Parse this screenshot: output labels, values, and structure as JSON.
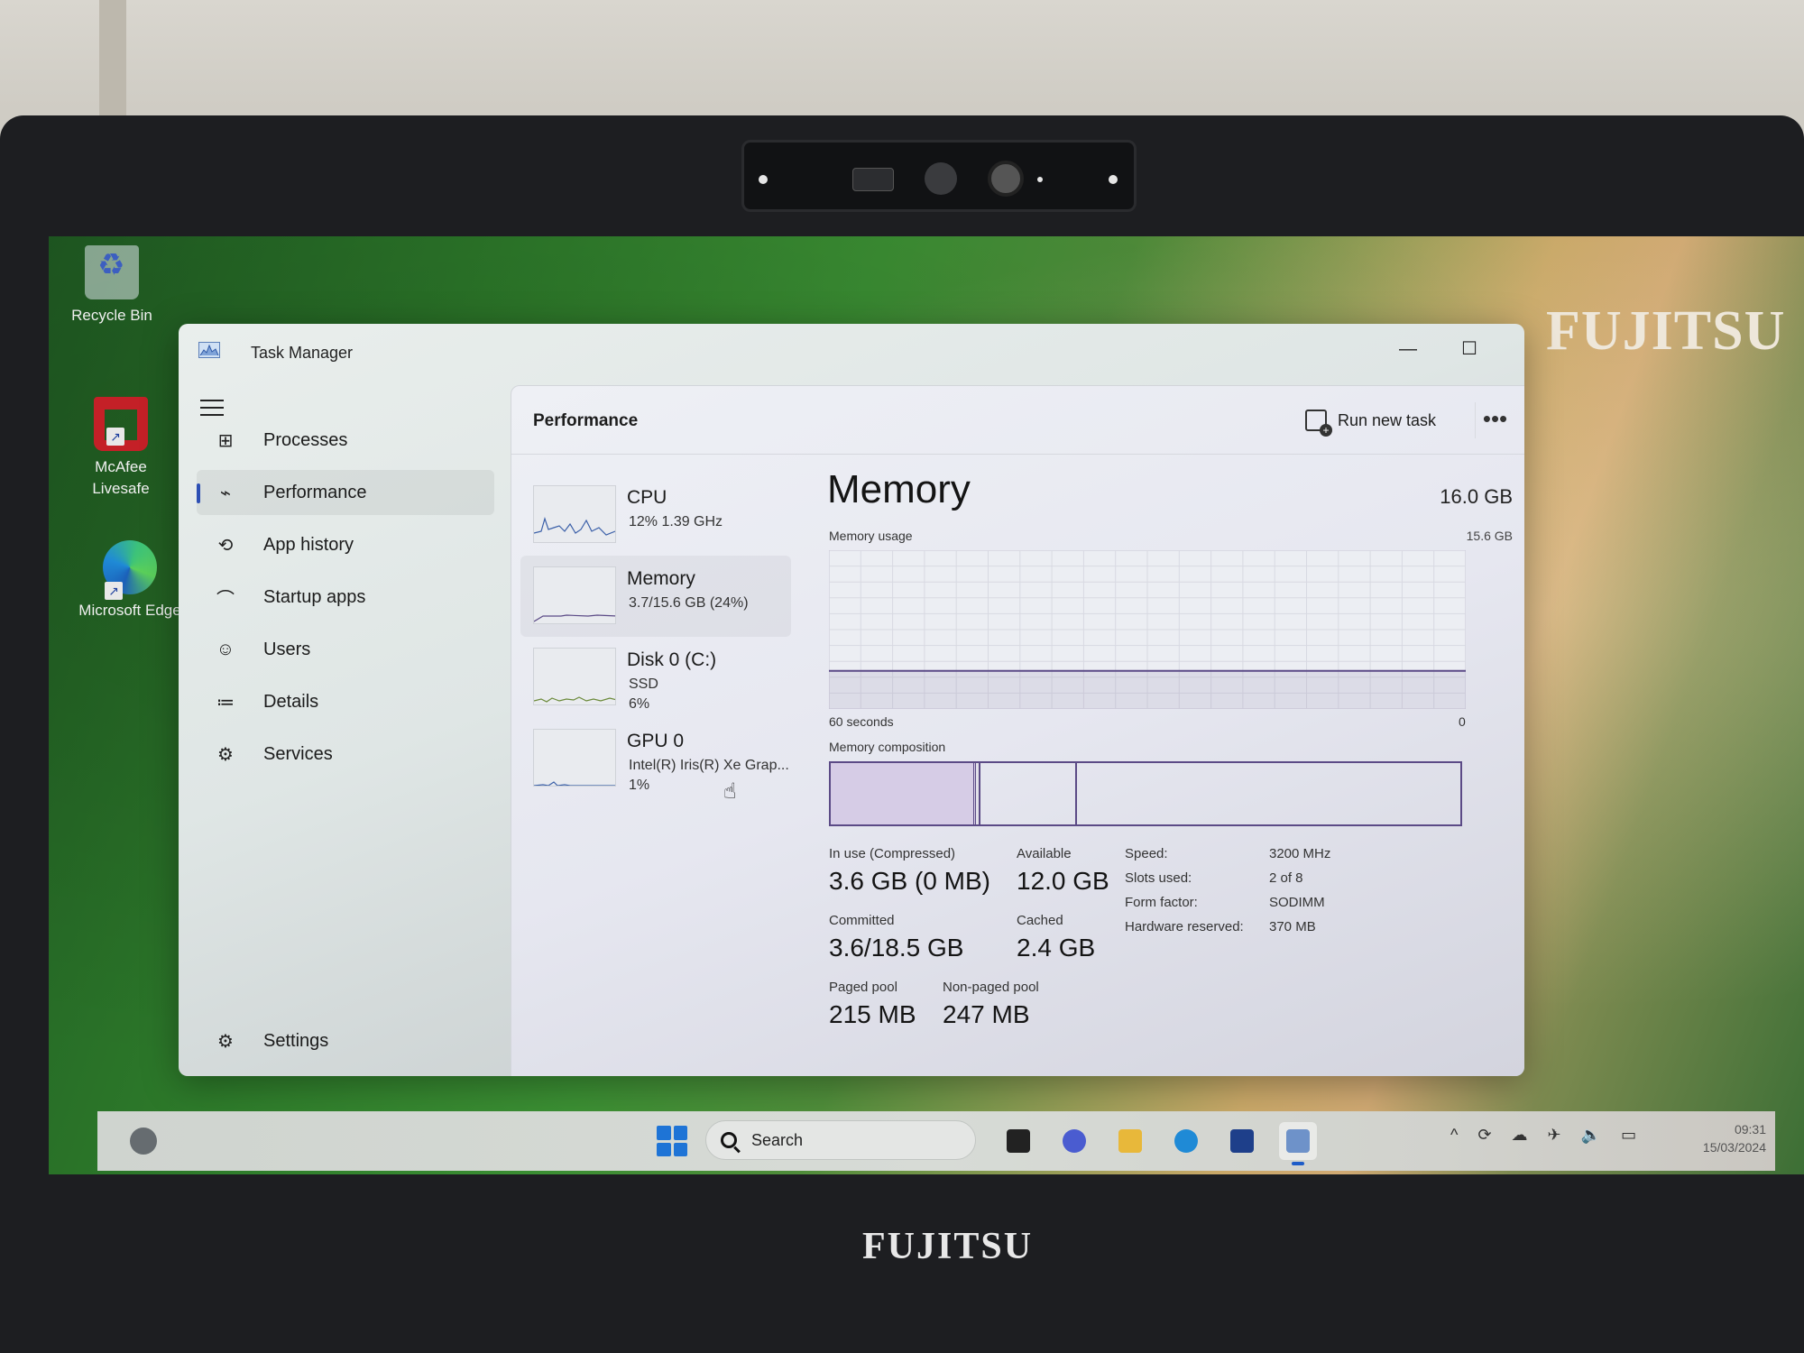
{
  "desktop": {
    "brand": "FUJITSU",
    "icons": [
      {
        "label": "Recycle Bin",
        "icon": "recycle-bin-icon"
      },
      {
        "label": "McAfee Livesafe",
        "icon": "mcafee-icon"
      },
      {
        "label": "Microsoft Edge",
        "icon": "edge-icon"
      }
    ]
  },
  "laptop": {
    "bezel_brand": "FUJITSU"
  },
  "window": {
    "title": "Task Manager",
    "controls": {
      "minimize": "—",
      "maximize": "☐",
      "close": "✕"
    }
  },
  "sidebar": {
    "menu_icon": "hamburger-icon",
    "items": [
      {
        "label": "Processes",
        "icon": "processes-icon",
        "glyph": "⊞",
        "active": false
      },
      {
        "label": "Performance",
        "icon": "performance-icon",
        "glyph": "⌁",
        "active": true
      },
      {
        "label": "App history",
        "icon": "app-history-icon",
        "glyph": "⟲",
        "active": false
      },
      {
        "label": "Startup apps",
        "icon": "startup-apps-icon",
        "glyph": "⌒",
        "active": false
      },
      {
        "label": "Users",
        "icon": "users-icon",
        "glyph": "☺",
        "active": false
      },
      {
        "label": "Details",
        "icon": "details-icon",
        "glyph": "≔",
        "active": false
      },
      {
        "label": "Services",
        "icon": "services-icon",
        "glyph": "⚙",
        "active": false
      }
    ],
    "settings_label": "Settings"
  },
  "header": {
    "title": "Performance",
    "run_new_task": "Run new task",
    "more": "•••"
  },
  "resources": [
    {
      "name": "CPU",
      "line1": "12%  1.39 GHz",
      "line2": "",
      "selected": false,
      "color": "#3a5fa8"
    },
    {
      "name": "Memory",
      "line1": "3.7/15.6 GB (24%)",
      "line2": "",
      "selected": true,
      "color": "#5b4a86"
    },
    {
      "name": "Disk 0 (C:)",
      "line1": "SSD",
      "line2": "6%",
      "selected": false,
      "color": "#6b8a3a"
    },
    {
      "name": "GPU 0",
      "line1": "Intel(R) Iris(R) Xe Grap...",
      "line2": "1%",
      "selected": false,
      "color": "#3a5fa8"
    }
  ],
  "memory": {
    "title": "Memory",
    "total": "16.0 GB",
    "usage_label": "Memory usage",
    "usage_max": "15.6 GB",
    "axis_left": "60 seconds",
    "axis_right": "0",
    "usage_fraction": 0.24,
    "composition_label": "Memory composition",
    "composition": {
      "in_use_gb": 3.6,
      "modified_gb": 0.1,
      "standby_gb": 2.4,
      "free_gb": 9.5
    },
    "stats": [
      {
        "label": "In use (Compressed)",
        "value": "3.6 GB (0 MB)"
      },
      {
        "label": "Available",
        "value": "12.0 GB"
      },
      {
        "label": "Committed",
        "value": "3.6/18.5 GB"
      },
      {
        "label": "Cached",
        "value": "2.4 GB"
      },
      {
        "label": "Paged pool",
        "value": "215 MB"
      },
      {
        "label": "Non-paged pool",
        "value": "247 MB"
      }
    ],
    "specs": [
      {
        "label": "Speed:",
        "value": "3200 MHz"
      },
      {
        "label": "Slots used:",
        "value": "2 of 8"
      },
      {
        "label": "Form factor:",
        "value": "SODIMM"
      },
      {
        "label": "Hardware reserved:",
        "value": "370 MB"
      }
    ]
  },
  "taskbar": {
    "search_placeholder": "Search",
    "apps": [
      {
        "name": "task-view-icon",
        "active": false
      },
      {
        "name": "teams-chat-icon",
        "active": false
      },
      {
        "name": "file-explorer-icon",
        "active": false
      },
      {
        "name": "edge-icon",
        "active": false
      },
      {
        "name": "microsoft-store-icon",
        "active": false
      },
      {
        "name": "task-manager-icon",
        "active": true
      }
    ],
    "tray": {
      "chevron": "^",
      "icons": [
        "sync-icon",
        "onedrive-icon",
        "airplane-icon",
        "volume-icon",
        "battery-icon"
      ]
    },
    "time": "09:31",
    "date": "15/03/2024"
  }
}
